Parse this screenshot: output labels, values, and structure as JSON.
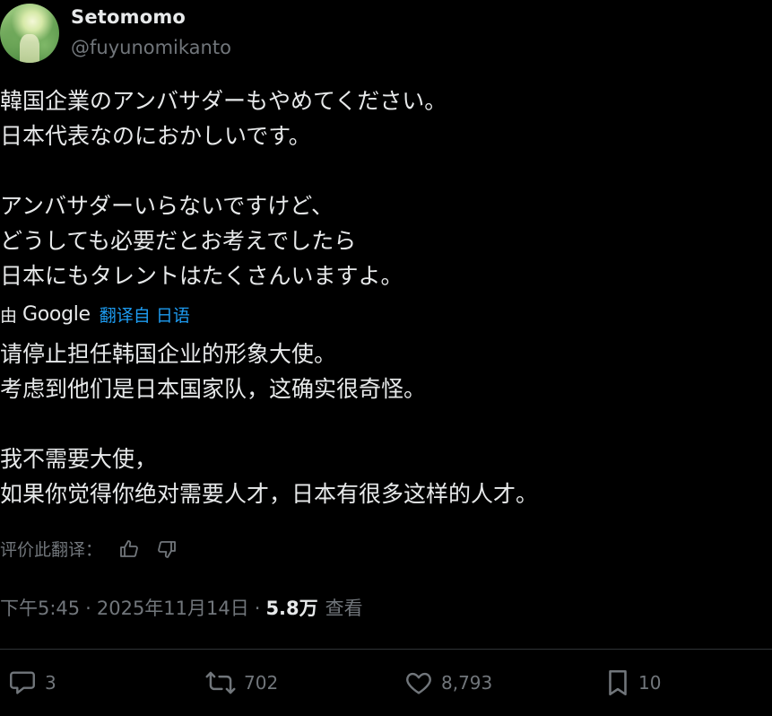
{
  "author": {
    "display_name": "Setomomo",
    "handle": "@fuyunomikanto"
  },
  "original_text": {
    "lines": [
      "韓国企業のアンバサダーもやめてください。",
      "日本代表なのにおかしいです。",
      "",
      "アンバサダーいらないですけど、",
      "どうしても必要だとお考えでしたら",
      "日本にもタレントはたくさんいますよ。"
    ]
  },
  "translation": {
    "prefix": "由",
    "provider": "Google",
    "link_label": "翻译自 日语",
    "lines": [
      "请停止担任韩国企业的形象大使。",
      "考虑到他们是日本国家队，这确实很奇怪。",
      "",
      "我不需要大使，",
      "如果你觉得你绝对需要人才，日本有很多这样的人才。"
    ],
    "rate_label": "评价此翻译："
  },
  "meta": {
    "time": "下午5:45",
    "separator": "·",
    "date": "2025年11月14日",
    "views_count": "5.8万",
    "views_label": "查看"
  },
  "actions": {
    "reply_count": "3",
    "retweet_count": "702",
    "like_count": "8,793",
    "bookmark_count": "10"
  },
  "colors": {
    "background": "#000000",
    "text": "#e7e9ea",
    "secondary": "#71767b",
    "link": "#1d9bf0",
    "divider": "#2f3336"
  },
  "icons": {
    "reply": "reply-icon",
    "retweet": "retweet-icon",
    "like": "like-icon",
    "bookmark": "bookmark-icon",
    "thumbs_up": "thumbs-up-icon",
    "thumbs_down": "thumbs-down-icon"
  }
}
